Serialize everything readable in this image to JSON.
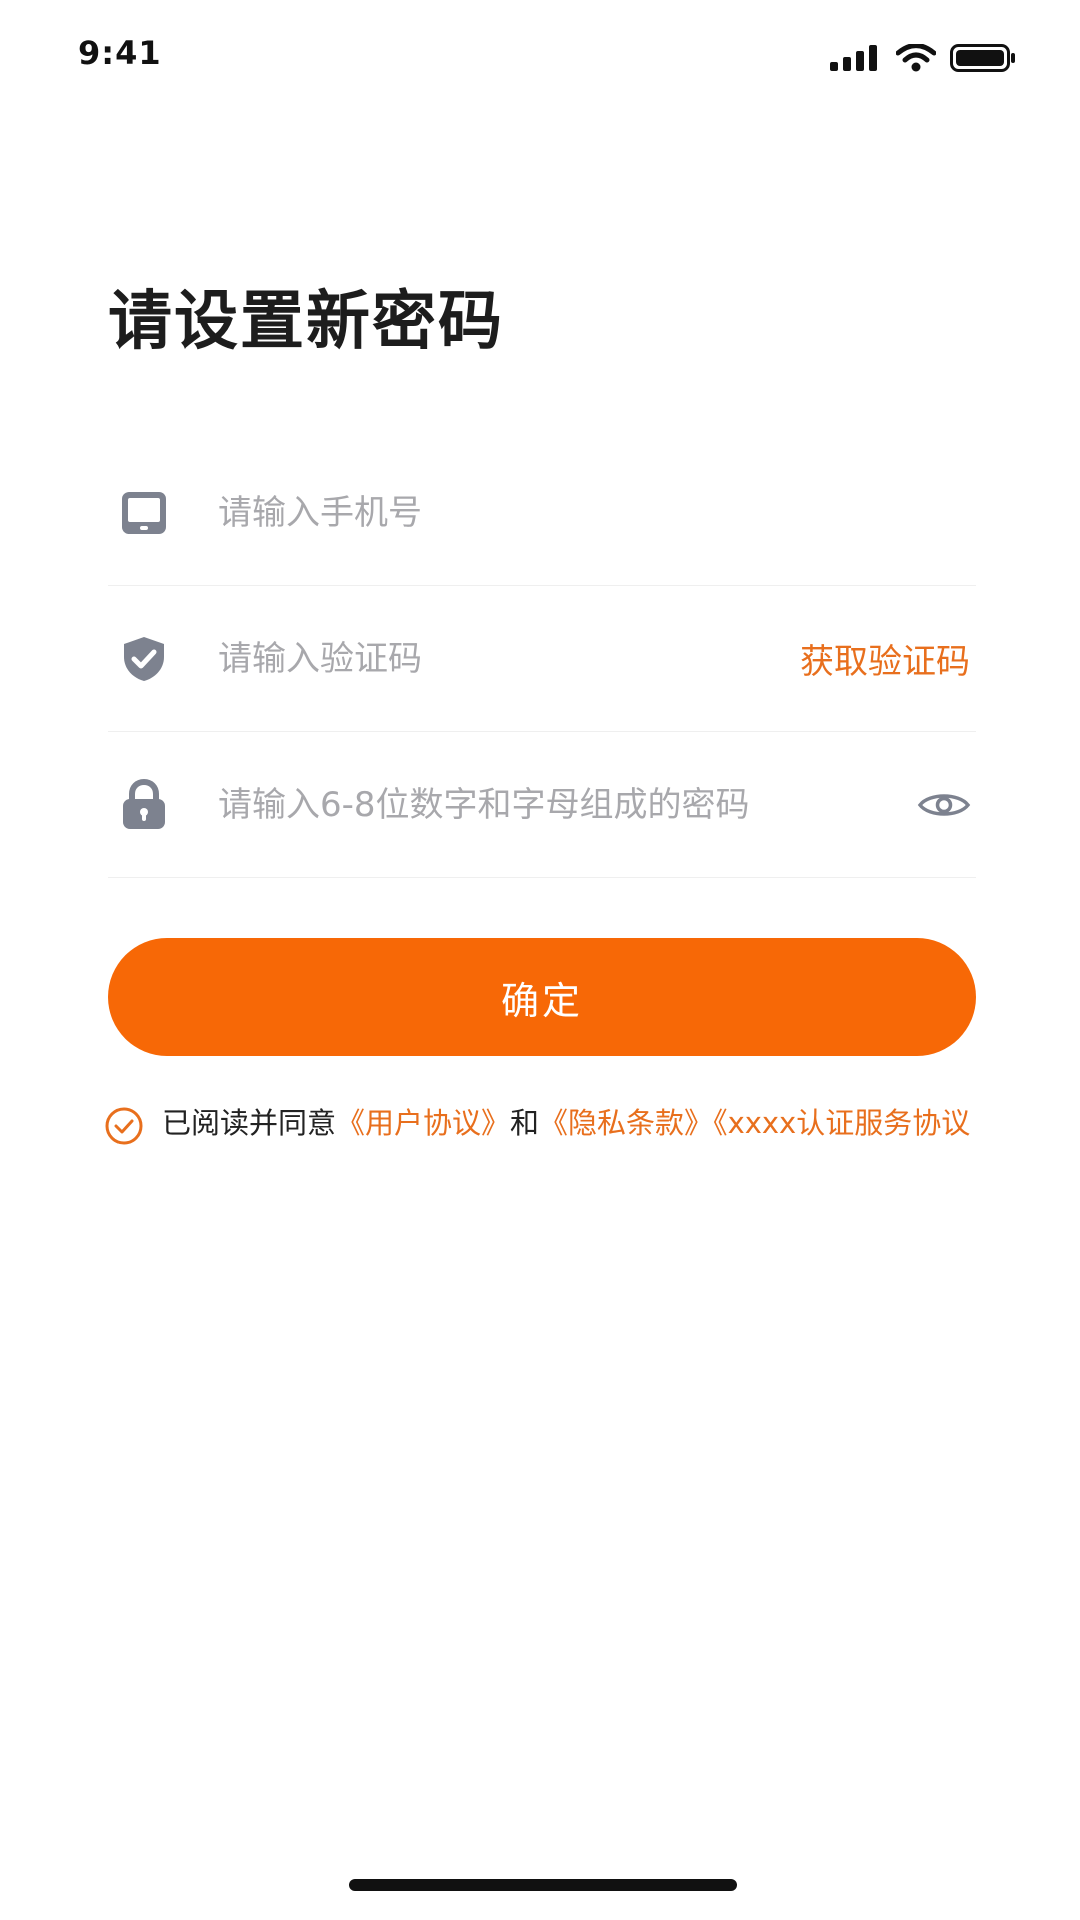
{
  "status_bar": {
    "time": "9:41",
    "icons": [
      "signal-icon",
      "wifi-icon",
      "battery-icon"
    ]
  },
  "title": "请设置新密码",
  "form": {
    "phone": {
      "placeholder": "请输入手机号",
      "value": "",
      "icon": "phone-icon"
    },
    "code": {
      "placeholder": "请输入验证码",
      "value": "",
      "icon": "shield-check-icon",
      "get_code_label": "获取验证码"
    },
    "password": {
      "placeholder": "请输入6-8位数字和字母组成的密码",
      "value": "",
      "icon": "lock-icon",
      "toggle_icon": "eye-icon"
    }
  },
  "confirm_label": "确定",
  "agreement": {
    "prefix": "已阅读并同意",
    "link_user": "《用户协议》",
    "and": "和",
    "link_privacy": "《隐私条款》",
    "link_cert": "《xxxx认证服务协议"
  },
  "colors": {
    "accent": "#f76806",
    "link": "#e86f1d",
    "icon_gray": "#7d828f",
    "placeholder": "#a8a8ac"
  }
}
